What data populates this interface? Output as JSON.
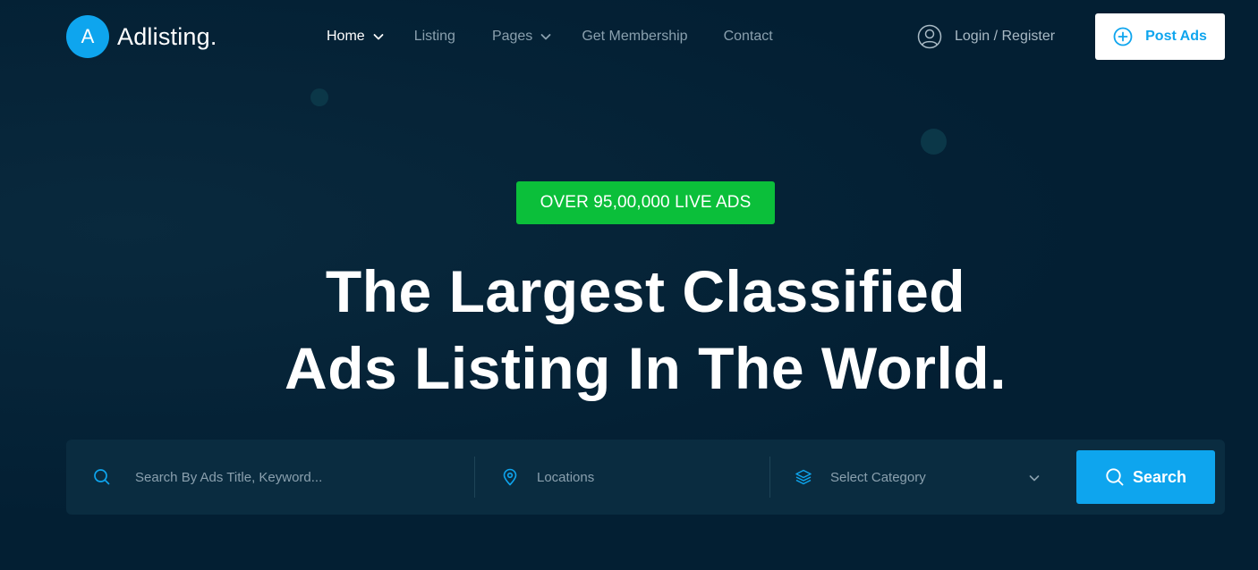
{
  "brand": {
    "logo_letter": "A",
    "name": "Adlisting."
  },
  "nav": {
    "home": "Home",
    "listing": "Listing",
    "pages": "Pages",
    "membership": "Get Membership",
    "contact": "Contact"
  },
  "header": {
    "login_label": "Login / Register",
    "post_label": "Post Ads"
  },
  "hero": {
    "badge": "OVER 95,00,000 LIVE ADS",
    "title_line1": "The Largest Classified",
    "title_line2": "Ads Listing In The World."
  },
  "search": {
    "keyword_placeholder": "Search By Ads Title, Keyword...",
    "location_placeholder": "Locations",
    "category_selected": "Select Category",
    "button_label": "Search"
  },
  "colors": {
    "background": "#031f33",
    "accent": "#0ea5ee",
    "badge": "#0bbf3a",
    "search_bar": "#0a2c40"
  },
  "icons": [
    "chevron-down-icon",
    "user-icon",
    "plus-circle-icon",
    "search-icon",
    "location-pin-icon",
    "layers-icon"
  ]
}
